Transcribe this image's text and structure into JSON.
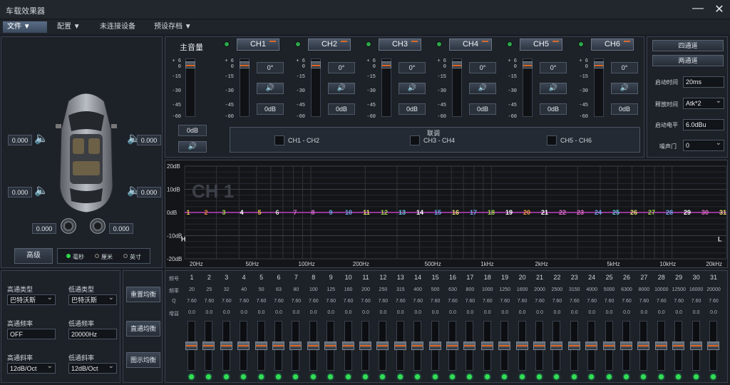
{
  "app": {
    "title": "车载效果器"
  },
  "window_controls": {
    "minimize": "—",
    "close": "✕"
  },
  "menu": [
    {
      "label": "文件 ▼",
      "active": true
    },
    {
      "label": "配置 ▼"
    },
    {
      "label": "未连接设备"
    },
    {
      "label": "预设存档 ▼"
    }
  ],
  "speakers": {
    "front_left": "0.000",
    "front_right": "0.000",
    "rear_left": "0.000",
    "rear_right": "0.000",
    "sub_left": "0.000",
    "sub_right": "0.000"
  },
  "advanced_button": "高级",
  "units": [
    "毫秒",
    "厘米",
    "英寸"
  ],
  "master": {
    "label": "主音量",
    "db": "0dB"
  },
  "meter_ticks": [
    "+ 6",
    "0",
    "-15",
    "-30",
    "-45",
    "-60"
  ],
  "channels": [
    {
      "name": "CH1",
      "phase": "0°",
      "db": "0dB"
    },
    {
      "name": "CH2",
      "phase": "0°",
      "db": "0dB"
    },
    {
      "name": "CH3",
      "phase": "0°",
      "db": "0dB"
    },
    {
      "name": "CH4",
      "phase": "0°",
      "db": "0dB"
    },
    {
      "name": "CH5",
      "phase": "0°",
      "db": "0dB"
    },
    {
      "name": "CH6",
      "phase": "0°",
      "db": "0dB"
    }
  ],
  "link": {
    "title": "联调",
    "pairs": [
      "CH1 - CH2",
      "CH3 - CH4",
      "CH5 - CH6"
    ]
  },
  "right_panel": {
    "four_ch": "四通道",
    "two_ch": "两通道",
    "attack_label": "启动时间",
    "attack_value": "20ms",
    "release_label": "释放时间",
    "release_value": "Atk*2",
    "threshold_label": "启动电平",
    "threshold_value": "6.0dBu",
    "noise_gate_label": "噪声门",
    "noise_gate_value": "0"
  },
  "graph": {
    "channel": "CH 1",
    "y_ticks": [
      "20dB",
      "10dB",
      "0dB",
      "-10dB",
      "-20dB"
    ],
    "x_ticks": [
      "20Hz",
      "50Hz",
      "100Hz",
      "200Hz",
      "500Hz",
      "1kHz",
      "2kHz",
      "5kHz",
      "10kHz",
      "20kHz"
    ],
    "hp_marker": "H",
    "lp_marker": "L",
    "point_colors": [
      "#e8c24a",
      "#f08a3a",
      "#9fd84a",
      "#ffffff",
      "#e8c24a",
      "#d8d8d8",
      "#d870d0",
      "#d870d0",
      "#6aa8e8",
      "#6aa8e8",
      "#e8e070",
      "#9fd84a",
      "#60c8e0",
      "#ffffff",
      "#6aa8e8",
      "#e8e070",
      "#6aa8e8",
      "#9fd84a",
      "#ffffff",
      "#f0a03a",
      "#ffffff",
      "#e070c8",
      "#e070c8",
      "#6aa8e8",
      "#60c8e0",
      "#e8e070",
      "#9fd84a",
      "#6aa8e8",
      "#ffffff",
      "#e070c8",
      "#e8e070"
    ]
  },
  "crossover": {
    "hp_type_label": "高通类型",
    "hp_type": "巴特沃斯",
    "lp_type_label": "低通类型",
    "lp_type": "巴特沃斯",
    "hp_freq_label": "高通频率",
    "hp_freq": "OFF",
    "lp_freq_label": "低通频率",
    "lp_freq": "20000Hz",
    "hp_slope_label": "高通斜率",
    "hp_slope": "12dB/Oct",
    "lp_slope_label": "低通斜率",
    "lp_slope": "12dB/Oct"
  },
  "eq_buttons": [
    "重置均衡",
    "直通均衡",
    "图示均衡"
  ],
  "eq": {
    "row_labels": [
      "频号",
      "频率",
      "Q",
      "增益"
    ],
    "bands": [
      "1",
      "2",
      "3",
      "4",
      "5",
      "6",
      "7",
      "8",
      "9",
      "10",
      "11",
      "12",
      "13",
      "14",
      "15",
      "16",
      "17",
      "18",
      "19",
      "20",
      "21",
      "22",
      "23",
      "24",
      "25",
      "26",
      "27",
      "28",
      "29",
      "30",
      "31"
    ],
    "freqs": [
      "20",
      "25",
      "32",
      "40",
      "50",
      "63",
      "80",
      "100",
      "125",
      "160",
      "200",
      "250",
      "315",
      "400",
      "500",
      "630",
      "800",
      "1000",
      "1250",
      "1600",
      "2000",
      "2500",
      "3150",
      "4000",
      "5000",
      "6300",
      "8000",
      "10000",
      "12500",
      "16000",
      "20000"
    ],
    "q": "7.60",
    "gain": "0.0"
  }
}
